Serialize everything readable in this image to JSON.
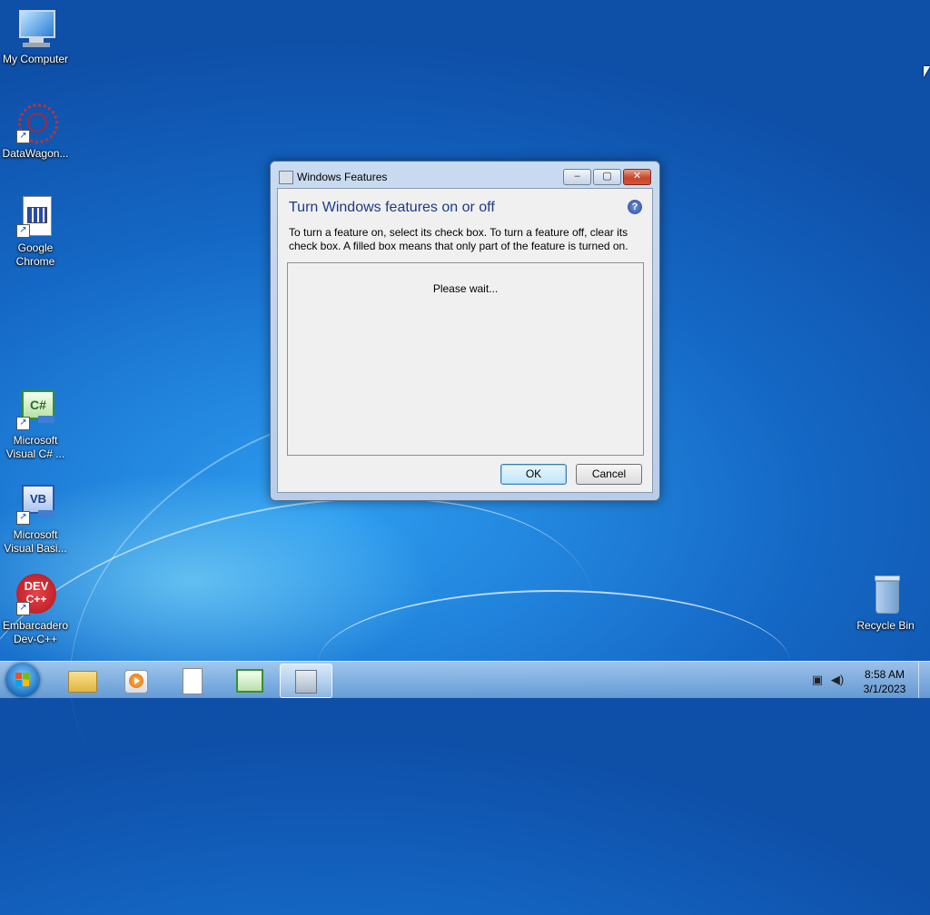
{
  "desktop": {
    "icons": [
      {
        "label": "My Computer",
        "icon": "computer-icon"
      },
      {
        "label": "DataWagon...",
        "icon": "datawagon-icon"
      },
      {
        "label": "Google Chrome",
        "icon": "chrome-shortcut-icon"
      },
      {
        "label": "Microsoft Visual C# ...",
        "icon": "visual-csharp-icon"
      },
      {
        "label": "Microsoft Visual Basi...",
        "icon": "visual-basic-icon"
      },
      {
        "label": "Embarcadero Dev-C++",
        "icon": "devcpp-icon"
      },
      {
        "label": "Recycle Bin",
        "icon": "recycle-bin-icon"
      }
    ],
    "vb_glyph": "VB",
    "cs_glyph": "C#",
    "dev_glyph_top": "DEV",
    "dev_glyph_bottom": "C++"
  },
  "dialog": {
    "title": "Windows Features",
    "minimize": "‒",
    "maximize": "▢",
    "close": "✕",
    "heading": "Turn Windows features on or off",
    "help": "?",
    "description": "To turn a feature on, select its check box. To turn a feature off, clear its check box. A filled box means that only part of the feature is turned on.",
    "status": "Please wait...",
    "ok_label": "OK",
    "cancel_label": "Cancel"
  },
  "taskbar": {
    "pinned": [
      "explorer-icon",
      "media-player-icon",
      "document-icon",
      "visual-csharp-icon",
      "windows-features-icon"
    ],
    "active_index": 4,
    "tray": {
      "network": "network-icon",
      "volume": "volume-icon"
    },
    "time": "8:58 AM",
    "date": "3/1/2023"
  },
  "colors": {
    "desktop": "#1f7fd8",
    "heading": "#1c3a8a",
    "close_button": "#c8452b"
  }
}
